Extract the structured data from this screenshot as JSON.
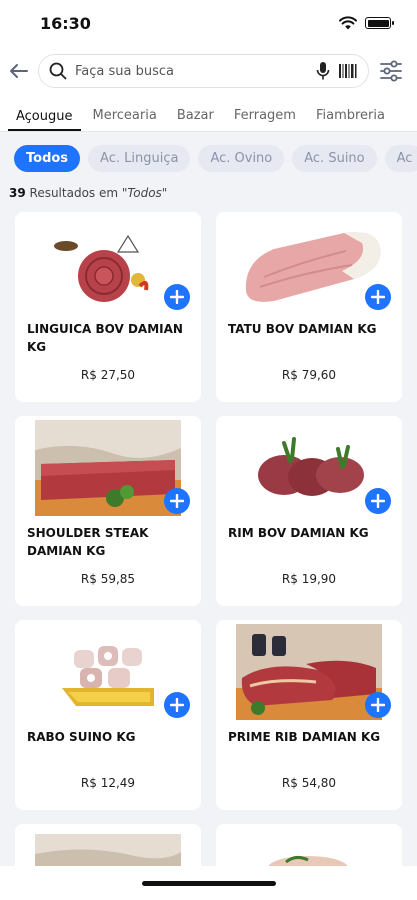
{
  "status": {
    "time": "16:30"
  },
  "search": {
    "placeholder": "Faça sua busca"
  },
  "tabs": [
    {
      "label": "Açougue",
      "active": true
    },
    {
      "label": "Mercearia"
    },
    {
      "label": "Bazar"
    },
    {
      "label": "Ferragem"
    },
    {
      "label": "Fiambreria"
    }
  ],
  "chips": [
    {
      "label": "Todos",
      "active": true
    },
    {
      "label": "Ac. Linguiça"
    },
    {
      "label": "Ac. Ovino"
    },
    {
      "label": "Ac. Suino"
    },
    {
      "label": "Ac"
    }
  ],
  "results": {
    "count": "39",
    "text": " Resultados em \"",
    "filter": "Todos",
    "close": "\""
  },
  "products": [
    {
      "name": "LINGUICA BOV DAMIAN KG",
      "price": "R$ 27,50"
    },
    {
      "name": "TATU BOV DAMIAN KG",
      "price": "R$ 79,60"
    },
    {
      "name": "SHOULDER STEAK DAMIAN KG",
      "price": "R$ 59,85"
    },
    {
      "name": "RIM BOV DAMIAN KG",
      "price": "R$ 19,90"
    },
    {
      "name": "RABO SUINO KG",
      "price": "R$ 12,49"
    },
    {
      "name": "PRIME RIB DAMIAN KG",
      "price": "R$ 54,80"
    }
  ],
  "icons": {
    "back": "arrow-left-icon",
    "search": "search-icon",
    "mic": "microphone-icon",
    "barcode": "barcode-icon",
    "filter": "filter-sliders-icon",
    "add": "plus-icon"
  },
  "colors": {
    "accent": "#1e73ff",
    "chip_bg": "#e6e9f1",
    "background": "#f2f3f7"
  }
}
